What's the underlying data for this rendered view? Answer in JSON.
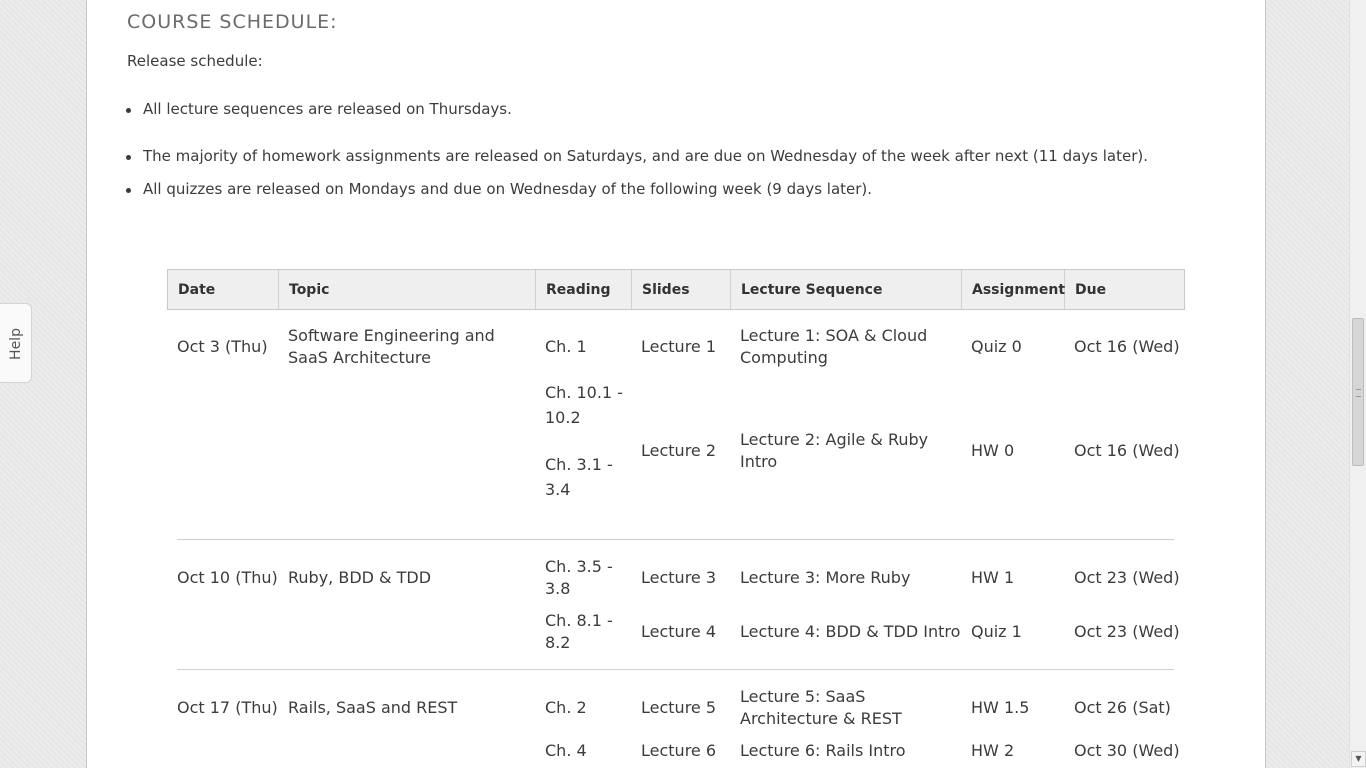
{
  "section_title": "COURSE SCHEDULE:",
  "intro": "Release schedule:",
  "rules": [
    "All lecture sequences are released on Thursdays.",
    "The majority of homework assignments are released on Saturdays, and are due on Wednesday of the week after next (11 days later).",
    "All quizzes are released on Mondays and due on Wednesday of the following week (9 days later)."
  ],
  "table": {
    "headers": [
      "Date",
      "Topic",
      "Reading",
      "Slides",
      "Lecture Sequence",
      "Assignment",
      "Due"
    ],
    "weeks": [
      {
        "date": "Oct 3 (Thu)",
        "topic": "Software Engineering and SaaS Architecture",
        "readings": [
          "Ch. 1",
          "Ch. 10.1 - 10.2",
          "Ch. 3.1 - 3.4"
        ],
        "rows": [
          {
            "slides": "Lecture 1",
            "sequence": "Lecture 1: SOA & Cloud Computing",
            "assignment": "Quiz 0",
            "due": "Oct 16 (Wed)"
          },
          {
            "slides": "Lecture 2",
            "sequence": "Lecture 2: Agile & Ruby Intro",
            "assignment": "HW 0",
            "due": "Oct 16 (Wed)"
          }
        ]
      },
      {
        "date": "Oct 10 (Thu)",
        "topic": "Ruby, BDD & TDD",
        "readings": [
          "Ch. 3.5 - 3.8",
          "Ch. 8.1 - 8.2"
        ],
        "rows": [
          {
            "slides": "Lecture 3",
            "sequence": "Lecture 3: More Ruby",
            "assignment": "HW 1",
            "due": "Oct 23 (Wed)"
          },
          {
            "slides": "Lecture 4",
            "sequence": "Lecture 4: BDD & TDD Intro",
            "assignment": "Quiz 1",
            "due": "Oct 23 (Wed)"
          }
        ]
      },
      {
        "date": "Oct 17 (Thu)",
        "topic": "Rails, SaaS and REST",
        "readings": [
          "Ch. 2",
          "Ch. 4"
        ],
        "rows": [
          {
            "slides": "Lecture 5",
            "sequence": "Lecture 5: SaaS Architecture & REST",
            "assignment": "HW 1.5",
            "due": "Oct 26 (Sat)"
          },
          {
            "slides": "Lecture 6",
            "sequence": "Lecture 6: Rails Intro",
            "assignment": "HW 2",
            "due": "Oct 30 (Wed)"
          }
        ]
      }
    ]
  },
  "help_tab": "Help"
}
